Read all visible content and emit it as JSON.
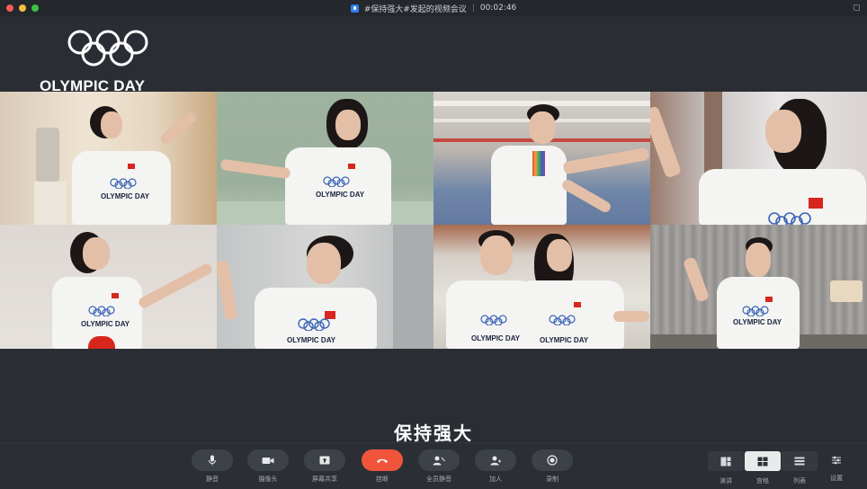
{
  "window": {
    "title": "#保持强大#发起的视频会议",
    "separator": "|",
    "timer": "00:02:46",
    "traffic_colors": [
      "#f25f58",
      "#f8bd3a",
      "#3ec244"
    ]
  },
  "logo": {
    "text": "OLYMPIC DAY"
  },
  "participants": [
    {
      "shirt_text": "OLYMPIC DAY"
    },
    {
      "shirt_text": "OLYMPIC DAY"
    },
    {
      "shirt_text": ""
    },
    {
      "shirt_text": ""
    },
    {
      "shirt_text": "OLYMPIC DAY"
    },
    {
      "shirt_text": "OLYMPIC DAY"
    },
    {
      "shirt_text": "OLYMPIC DAY"
    },
    {
      "shirt_text": "OLYMPIC DAY"
    }
  ],
  "extra_shirt_text": "OLYMPIC DAY",
  "subtitle": "保持强大",
  "toolbar": {
    "mute": "静音",
    "camera": "摄像头",
    "share": "屏幕共享",
    "leave": "挂断",
    "mute_all": "全员静音",
    "invite": "加人",
    "record": "录制"
  },
  "views": {
    "speaker": "演讲",
    "gallery": "宫格",
    "list": "列表",
    "settings": "设置"
  },
  "colors": {
    "accent_red": "#f0553c",
    "background": "#2a2e34",
    "toolbar": "#2b2f35"
  }
}
